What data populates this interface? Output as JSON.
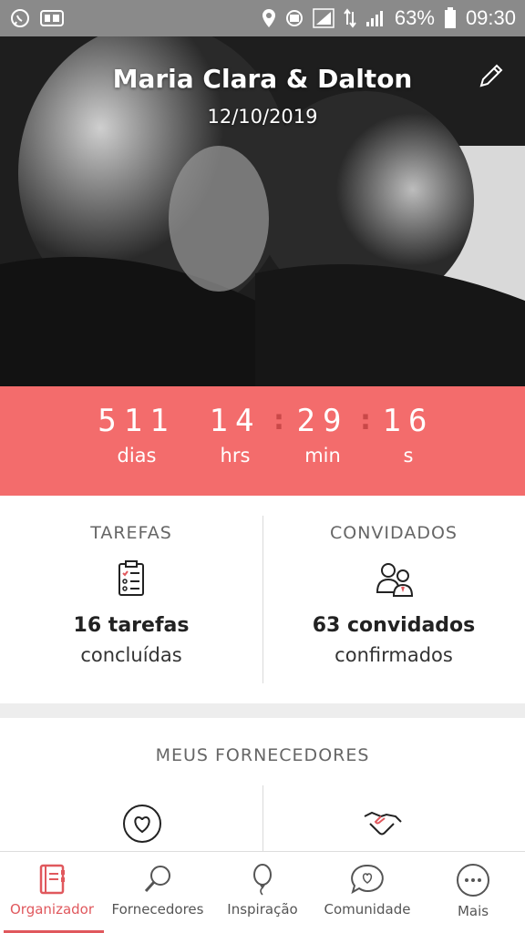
{
  "statusbar": {
    "battery": "63%",
    "time": "09:30"
  },
  "hero": {
    "couple_names": "Maria Clara & Dalton",
    "wedding_date": "12/10/2019"
  },
  "countdown": {
    "days": "511",
    "days_label": "dias",
    "hours": "14",
    "hours_label": "hrs",
    "minutes": "29",
    "minutes_label": "min",
    "seconds": "16",
    "seconds_label": "s",
    "separator": ":"
  },
  "stats": {
    "tasks": {
      "title": "TAREFAS",
      "count": "16 tarefas",
      "sub": "concluídas",
      "icon": "checklist-icon"
    },
    "guests": {
      "title": "CONVIDADOS",
      "count": "63 convidados",
      "sub": "confirmados",
      "icon": "guests-icon"
    }
  },
  "suppliers": {
    "title": "MEUS FORNECEDORES",
    "icons": [
      "heart-icon",
      "handshake-icon"
    ]
  },
  "bottom_nav": {
    "items": [
      {
        "label": "Organizador",
        "icon": "planner-icon",
        "active": true
      },
      {
        "label": "Fornecedores",
        "icon": "magnifier-icon",
        "active": false
      },
      {
        "label": "Inspiração",
        "icon": "balloon-icon",
        "active": false
      },
      {
        "label": "Comunidade",
        "icon": "chat-heart-icon",
        "active": false
      },
      {
        "label": "Mais",
        "icon": "more-icon",
        "active": false
      }
    ]
  },
  "colors": {
    "accent": "#f36c6c",
    "nav_active": "#e0585d",
    "statusbar": "#8a8a8a"
  }
}
